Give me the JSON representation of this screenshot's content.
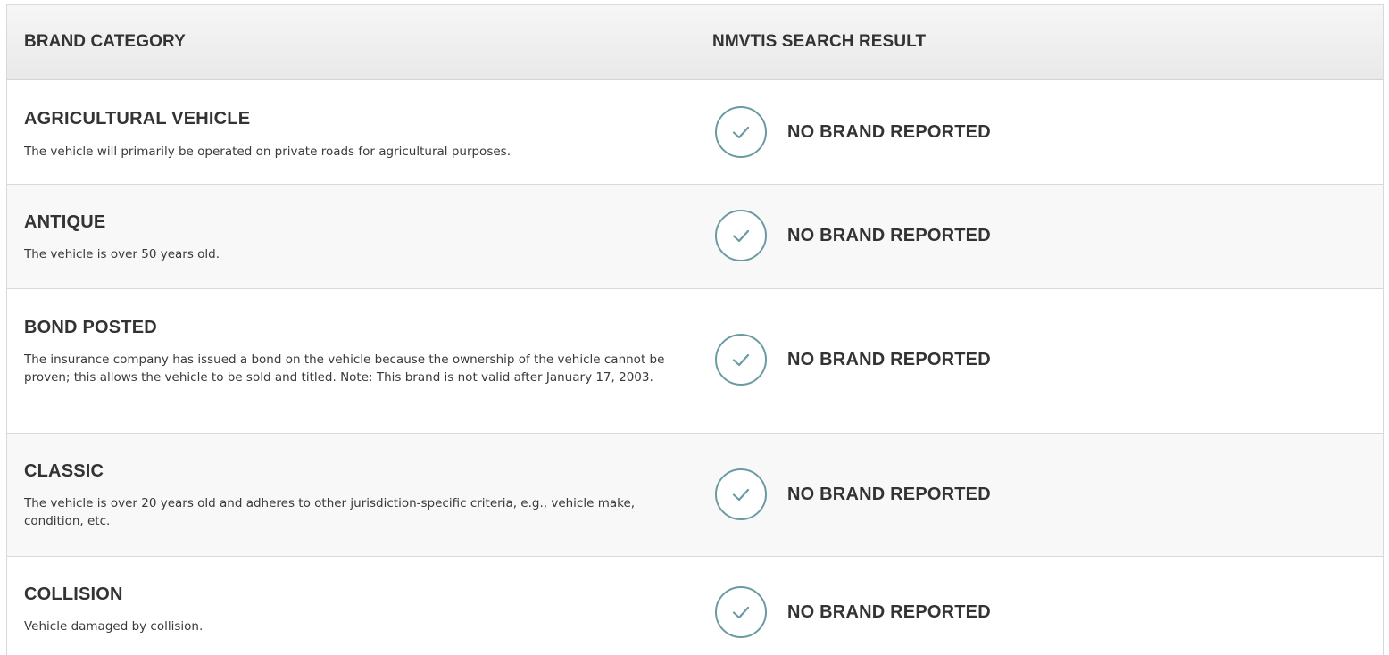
{
  "table": {
    "headers": {
      "brand_category": "BRAND CATEGORY",
      "nmvtis_search_result": "NMVTIS SEARCH RESULT"
    },
    "rows": [
      {
        "title": "AGRICULTURAL VEHICLE",
        "description": "The vehicle will primarily be operated on private roads for agricultural purposes.",
        "result": "NO BRAND REPORTED",
        "result_icon": "check-circle-icon"
      },
      {
        "title": "ANTIQUE",
        "description": "The vehicle is over 50 years old.",
        "result": "NO BRAND REPORTED",
        "result_icon": "check-circle-icon"
      },
      {
        "title": "BOND POSTED",
        "description": "The insurance company has issued a bond on the vehicle because the ownership of the vehicle cannot be proven; this allows the vehicle to be sold and titled. Note: This brand is not valid after January 17, 2003.",
        "result": "NO BRAND REPORTED",
        "result_icon": "check-circle-icon"
      },
      {
        "title": "CLASSIC",
        "description": "The vehicle is over 20 years old and adheres to other jurisdiction-specific criteria, e.g., vehicle make, condition, etc.",
        "result": "NO BRAND REPORTED",
        "result_icon": "check-circle-icon"
      },
      {
        "title": "COLLISION",
        "description": "Vehicle damaged by collision.",
        "result": "NO BRAND REPORTED",
        "result_icon": "check-circle-icon"
      }
    ]
  },
  "colors": {
    "check_ring": "#6a9ba3",
    "header_bg": "#efefef",
    "row_alt_bg": "#f8f8f8",
    "text": "#333333"
  }
}
